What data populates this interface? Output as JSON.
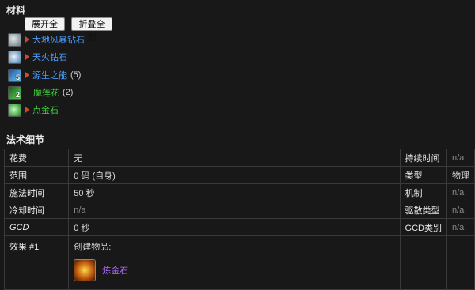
{
  "materials_heading": "材料",
  "buttons": {
    "expand_all": "展开全部",
    "collapse_all": "折叠全部"
  },
  "materials": [
    {
      "name": "大地风暴钻石",
      "color": "#4d9dff",
      "count": "",
      "expandable": true,
      "icon": "diamond-icon"
    },
    {
      "name": "天火钻石",
      "color": "#4d9dff",
      "count": "",
      "expandable": true,
      "icon": "diamond-icon"
    },
    {
      "name": "源生之能",
      "color": "#4d9dff",
      "count": "(5)",
      "expandable": true,
      "icon": "primal-icon",
      "badge": "5"
    },
    {
      "name": "魔莲花",
      "color": "#3ed23e",
      "count": "(2)",
      "expandable": false,
      "icon": "lotus-icon",
      "badge": "2"
    },
    {
      "name": "点金石",
      "color": "#3ed23e",
      "count": "",
      "expandable": true,
      "icon": "stone-icon"
    }
  ],
  "spell_heading": "法术细节",
  "details": {
    "cost_k": "花费",
    "cost_v": "无",
    "range_k": "范围",
    "range_v": "0 码 (自身)",
    "cast_k": "施法时间",
    "cast_v": "50 秒",
    "cooldown_k": "冷却时间",
    "cooldown_v": "n/a",
    "gcd_k": "GCD",
    "gcd_v": "0 秒",
    "effect_k": "效果 #1",
    "effect_v": "创建物品:",
    "created_item": "炼金石",
    "duration_k": "持续时间",
    "duration_v": "n/a",
    "type_k": "类型",
    "type_v": "物理",
    "mechanic_k": "机制",
    "mechanic_v": "n/a",
    "dispel_k": "驱散类型",
    "dispel_v": "n/a",
    "gcdcat_k": "GCD类别",
    "gcdcat_v": "n/a"
  },
  "colors": {
    "blue_link": "#4d9dff",
    "green_link": "#3ed23e",
    "purple_link": "#b06cff",
    "expand_triangle": "#d04a2a"
  }
}
